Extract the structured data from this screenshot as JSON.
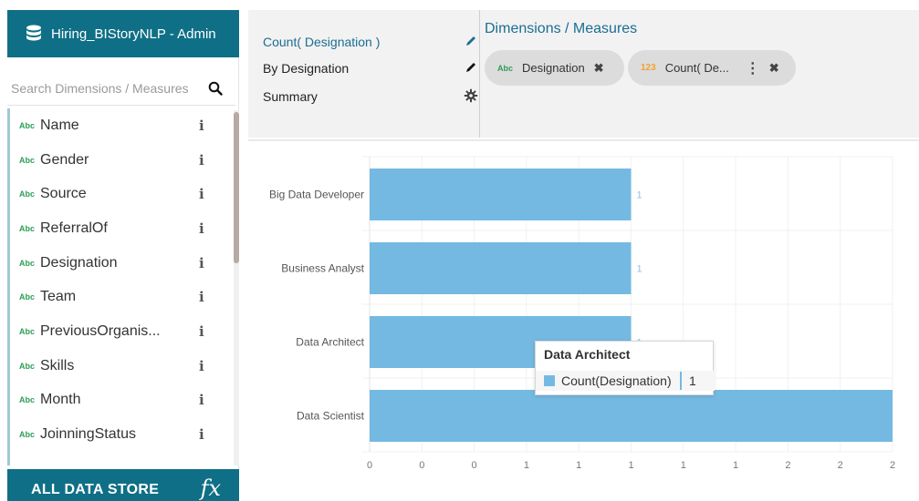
{
  "sidebar": {
    "title": "Hiring_BIStoryNLP - Admin",
    "search_placeholder": "Search Dimensions / Measures",
    "fields": [
      {
        "type": "Abc",
        "name": "Name"
      },
      {
        "type": "Abc",
        "name": "Gender"
      },
      {
        "type": "Abc",
        "name": "Source"
      },
      {
        "type": "Abc",
        "name": "ReferralOf"
      },
      {
        "type": "Abc",
        "name": "Designation"
      },
      {
        "type": "Abc",
        "name": "Team"
      },
      {
        "type": "Abc",
        "name": "PreviousOrganis..."
      },
      {
        "type": "Abc",
        "name": "Skills"
      },
      {
        "type": "Abc",
        "name": "Month"
      },
      {
        "type": "Abc",
        "name": "JoinningStatus"
      }
    ],
    "info_glyph": "i",
    "footer_label": "ALL DATA STORE",
    "footer_fx": "fx"
  },
  "viz": {
    "measure_label": "Count( Designation )",
    "dimension_label": "By Designation",
    "summary_label": "Summary"
  },
  "dims": {
    "title": "Dimensions / Measures",
    "pills": [
      {
        "type": "Abc",
        "name": "Designation",
        "close": "✖"
      },
      {
        "type": "123",
        "name": "Count( De...",
        "more": "⋮",
        "close": "✖"
      }
    ]
  },
  "colors": {
    "header_bg": "#0f6f86",
    "bar": "#74b9e2",
    "accent_text": "#1a6e92",
    "dimension_tag": "#2e9e57",
    "measure_tag": "#f0a330"
  },
  "chart_data": {
    "type": "bar",
    "orientation": "horizontal",
    "categories": [
      "Big Data Developer",
      "Business Analyst",
      "Data Architect",
      "Data Scientist"
    ],
    "series": [
      {
        "name": "Count(Designation)",
        "values": [
          1,
          1,
          1,
          2
        ]
      }
    ],
    "data_labels": [
      "1",
      "1",
      "1",
      ""
    ],
    "x_ticks": [
      "0",
      "0",
      "0",
      "1",
      "1",
      "1",
      "1",
      "1",
      "2",
      "2",
      "2"
    ],
    "xlim": [
      0,
      2
    ],
    "grid": true
  },
  "tooltip": {
    "title": "Data Architect",
    "series_name": "Count(Designation)",
    "value": "1"
  }
}
